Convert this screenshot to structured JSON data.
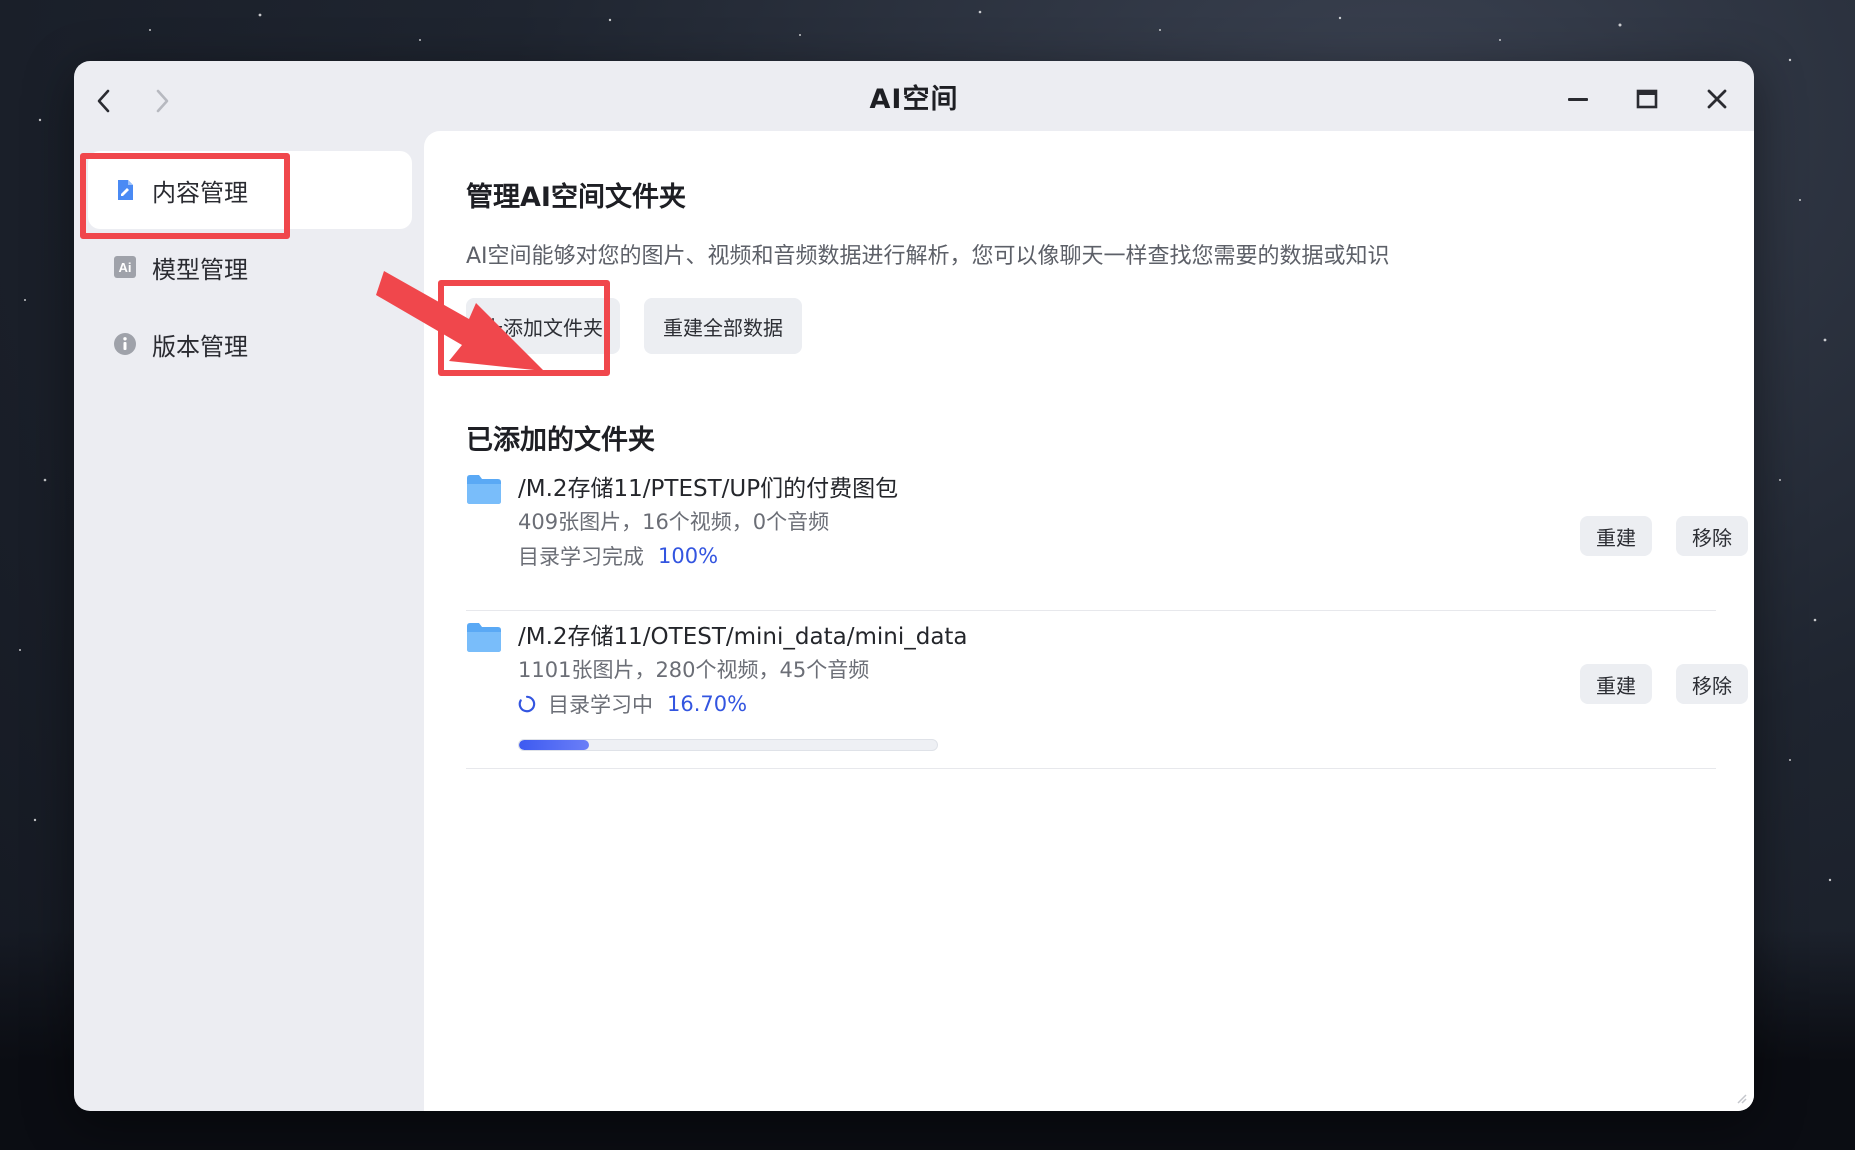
{
  "window": {
    "title": "AI空间"
  },
  "sidebar": {
    "items": [
      {
        "label": "内容管理",
        "icon": "document-edit-icon",
        "active": true
      },
      {
        "label": "模型管理",
        "icon": "ai-model-icon",
        "active": false
      },
      {
        "label": "版本管理",
        "icon": "info-icon",
        "active": false
      }
    ]
  },
  "main": {
    "heading": "管理AI空间文件夹",
    "description": "AI空间能够对您的图片、视频和音频数据进行解析，您可以像聊天一样查找您需要的数据或知识",
    "add_folder_label": "十添加文件夹",
    "rebuild_all_label": "重建全部数据",
    "added_heading": "已添加的文件夹",
    "folders": [
      {
        "path": "/M.2存储11/PTEST/UP们的付费图包",
        "stats": "409张图片，16个视频，0个音频",
        "status": "目录学习完成",
        "percent": "100%",
        "rebuild_label": "重建",
        "remove_label": "移除"
      },
      {
        "path": "/M.2存储11/OTEST/mini_data/mini_data",
        "stats": "1101张图片，280个视频，45个音频",
        "status": "目录学习中",
        "percent": "16.70%",
        "progress": 0.167,
        "rebuild_label": "重建",
        "remove_label": "移除"
      }
    ]
  },
  "colors": {
    "accent": "#3355e0",
    "highlight": "#f0474c",
    "folder": "#5aa9f5"
  }
}
